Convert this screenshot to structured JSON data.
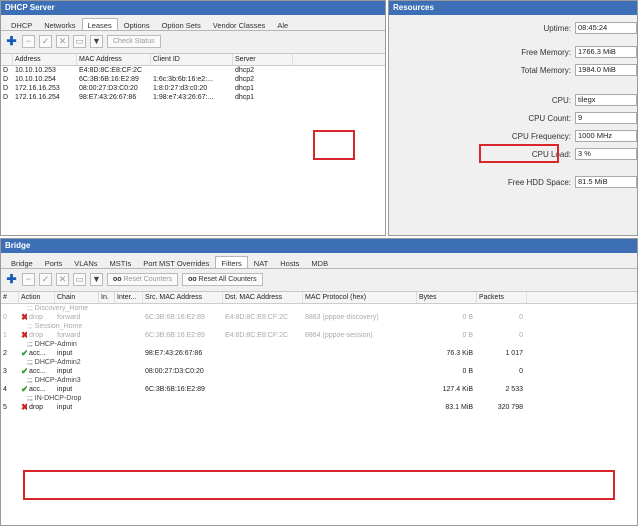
{
  "dhcp": {
    "title": "DHCP Server",
    "tabs": [
      "DHCP",
      "Networks",
      "Leases",
      "Options",
      "Option Sets",
      "Vendor Classes",
      "Ale"
    ],
    "check_status": "Check Status",
    "headers": [
      "",
      "Address",
      "MAC Address",
      "Client ID",
      "Server"
    ],
    "rows": [
      {
        "flag": "D",
        "address": "10.10.10.253",
        "mac": "E4:8D:8C:E8:CF:2C",
        "client": "",
        "server": "dhcp2"
      },
      {
        "flag": "D",
        "address": "10.10.10.254",
        "mac": "6C:3B:6B:16:E2:89",
        "client": "1:6c:3b:6b:16:e2:...",
        "server": "dhcp2"
      },
      {
        "flag": "D",
        "address": "172.16.16.253",
        "mac": "08:00:27:D3:C0:20",
        "client": "1:8:0:27:d3:c0:20",
        "server": "dhcp1"
      },
      {
        "flag": "D",
        "address": "172.16.16.254",
        "mac": "98:E7:43:26:67:86",
        "client": "1:98:e7:43:26:67:...",
        "server": "dhcp1"
      }
    ]
  },
  "resources": {
    "title": "Resources",
    "items": [
      {
        "label": "Uptime:",
        "value": "08:45:24"
      },
      {
        "label": "Free Memory:",
        "value": "1766.3 MiB"
      },
      {
        "label": "Total Memory:",
        "value": "1984.0 MiB"
      },
      {
        "label": "CPU:",
        "value": "tilegx"
      },
      {
        "label": "CPU Count:",
        "value": "9"
      },
      {
        "label": "CPU Frequency:",
        "value": "1000 MHz"
      },
      {
        "label": "CPU Load:",
        "value": "3 %"
      },
      {
        "label": "Free HDD Space:",
        "value": "81.5 MiB"
      }
    ]
  },
  "bridge": {
    "title": "Bridge",
    "tabs": [
      "Bridge",
      "Ports",
      "VLANs",
      "MSTIs",
      "Port MST Overrides",
      "Filters",
      "NAT",
      "Hosts",
      "MDB"
    ],
    "reset_counters": "Reset Counters",
    "reset_all": "Reset All Counters",
    "headers": [
      "#",
      "Action",
      "Chain",
      "In.",
      "Inter...",
      "Src. MAC Address",
      "Dst. MAC Address",
      "MAC Protocol (hex)",
      "Bytes",
      "Packets"
    ],
    "rules": [
      {
        "comment": ";;; Discovery_Home",
        "num": "0",
        "action": "drop",
        "chain": "forward",
        "src": "6C:3B:6B:16:E2:89",
        "dst": "E4:8D:8C:E8:CF:2C",
        "proto": "8863 (pppoe-discovery)",
        "bytes": "0 B",
        "packets": "0",
        "disabled": true,
        "ok": false
      },
      {
        "comment": ";;; Session_Home",
        "num": "1",
        "action": "drop",
        "chain": "forward",
        "src": "6C:3B:6B:16:E2:89",
        "dst": "E4:8D:8C:E8:CF:2C",
        "proto": "8864 (pppoe-session)",
        "bytes": "0 B",
        "packets": "0",
        "disabled": true,
        "ok": false
      },
      {
        "comment": ";;; DHCP-Admin",
        "num": "2",
        "action": "acc...",
        "chain": "input",
        "src": "98:E7:43:26:67:86",
        "dst": "",
        "proto": "",
        "bytes": "76.3 KiB",
        "packets": "1 017",
        "disabled": false,
        "ok": true
      },
      {
        "comment": ";;; DHCP-Admin2",
        "num": "3",
        "action": "acc...",
        "chain": "input",
        "src": "08:00:27:D3:C0:20",
        "dst": "",
        "proto": "",
        "bytes": "0 B",
        "packets": "0",
        "disabled": false,
        "ok": true
      },
      {
        "comment": ";;; DHCP-Admin3",
        "num": "4",
        "action": "acc...",
        "chain": "input",
        "src": "6C:3B:6B:16:E2:89",
        "dst": "",
        "proto": "",
        "bytes": "127.4 KiB",
        "packets": "2 533",
        "disabled": false,
        "ok": true
      },
      {
        "comment": ";;; IN-DHCP-Drop",
        "num": "5",
        "action": "drop",
        "chain": "input",
        "src": "",
        "dst": "",
        "proto": "",
        "bytes": "83.1 MiB",
        "packets": "320 798",
        "disabled": false,
        "ok": false
      }
    ]
  }
}
